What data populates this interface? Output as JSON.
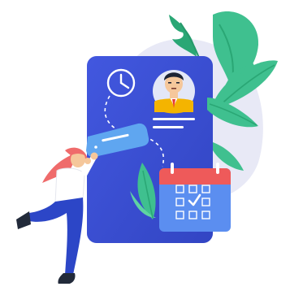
{
  "illustration": {
    "colors": {
      "card_blue": "#3a4fd6",
      "card_blue_dark": "#2d3fb8",
      "blob_lavender": "#e8e9f6",
      "leaf_green": "#3fc08f",
      "leaf_green_dark": "#2aa775",
      "calendar_blue": "#5b8ef0",
      "calendar_red": "#ee5a5a",
      "sticky_note": "#5fa6f0",
      "hair_coral": "#ef6b6b",
      "pants_blue": "#2c46c7",
      "skin": "#f5c79b",
      "avatar_yellow": "#f4b400"
    },
    "icons": [
      "clock-icon",
      "profile-avatar-icon",
      "calendar-icon",
      "checkmark-icon",
      "leaf-icon"
    ]
  }
}
